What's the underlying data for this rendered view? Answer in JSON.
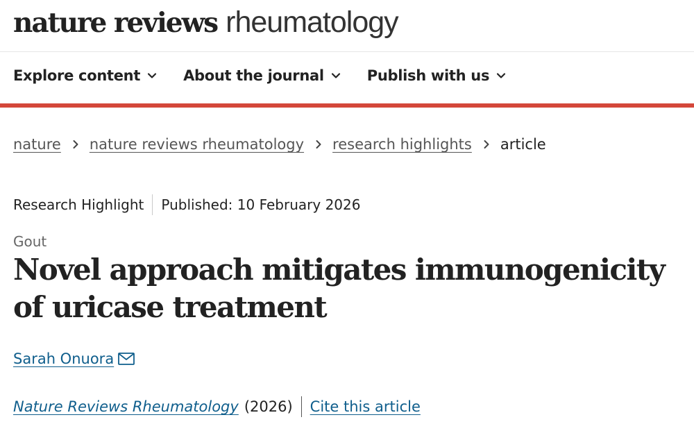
{
  "masthead": {
    "brand_bold": "nature reviews",
    "brand_light": "rheumatology"
  },
  "nav": {
    "items": [
      {
        "label": "Explore content",
        "icon": "chevron-down-icon"
      },
      {
        "label": "About the journal",
        "icon": "chevron-down-icon"
      },
      {
        "label": "Publish with us",
        "icon": "chevron-down-icon"
      }
    ],
    "accent_color": "#d4473a"
  },
  "breadcrumb": {
    "items": [
      {
        "label": "nature"
      },
      {
        "label": "nature reviews rheumatology"
      },
      {
        "label": "research highlights"
      }
    ],
    "current": "article",
    "separator_icon": "chevron-right-icon"
  },
  "article": {
    "type": "Research Highlight",
    "published": "Published: 10 February 2026",
    "subject": "Gout",
    "title": "Novel approach mitigates immunogenicity of uricase treatment",
    "author": {
      "name": "Sarah Onuora",
      "icon": "mail-icon"
    },
    "citation": {
      "journal": "Nature Reviews Rheumatology",
      "year": "(2026)",
      "cite_label": "Cite this article"
    },
    "link_color": "#0f5e8c"
  }
}
